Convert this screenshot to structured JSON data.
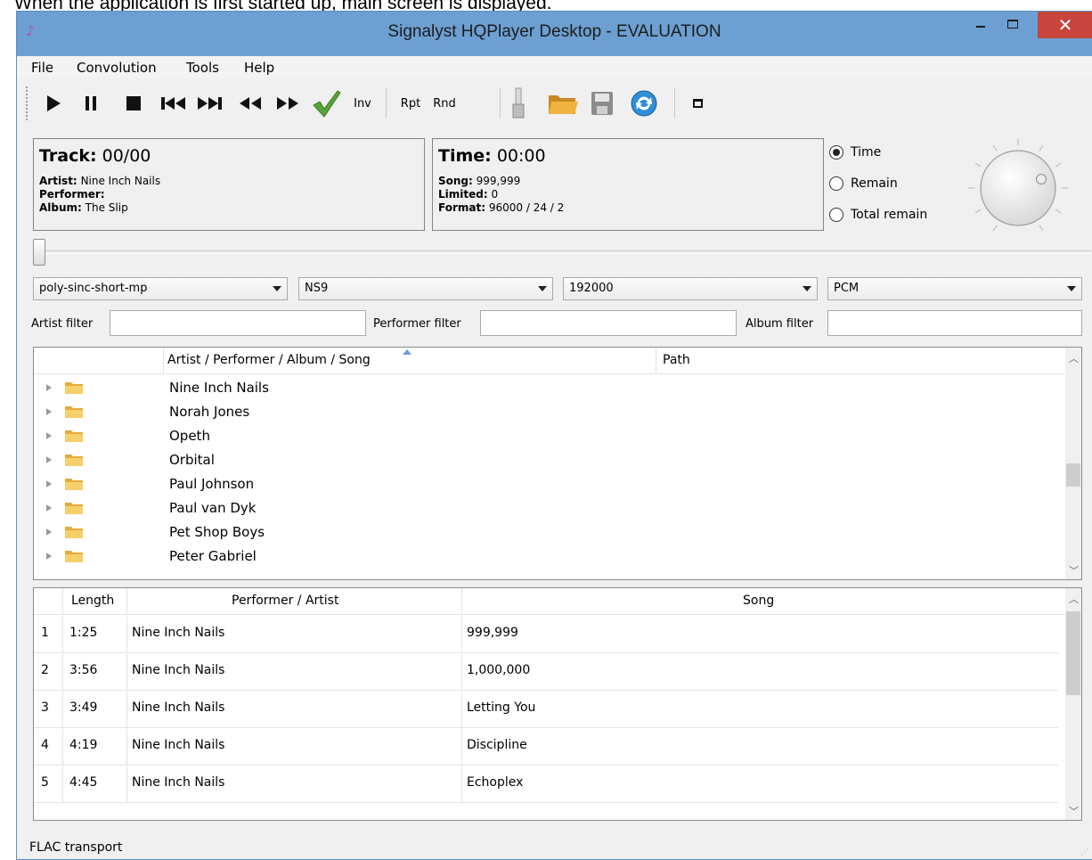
{
  "caption": "When the application is first started up, main screen is displayed.",
  "window": {
    "title": "Signalyst HQPlayer Desktop - EVALUATION"
  },
  "menu": [
    "File",
    "Convolution",
    "Tools",
    "Help"
  ],
  "toolbar": {
    "inv": "Inv",
    "rpt": "Rpt",
    "rnd": "Rnd"
  },
  "track_panel": {
    "track_label": "Track:",
    "track_value": "00/00",
    "artist_label": "Artist:",
    "artist": "Nine Inch Nails",
    "performer_label": "Performer:",
    "performer": "",
    "album_label": "Album:",
    "album": "The Slip"
  },
  "time_panel": {
    "time_label": "Time:",
    "time_value": "00:00",
    "song_label": "Song:",
    "song": "999,999",
    "limited_label": "Limited:",
    "limited": "0",
    "format_label": "Format:",
    "format": "96000 / 24 / 2"
  },
  "time_mode": {
    "options": [
      "Time",
      "Remain",
      "Total remain"
    ],
    "selected": "Time"
  },
  "combos": {
    "filter": "poly-sinc-short-mp",
    "shaper": "NS9",
    "rate": "192000",
    "mode": "PCM"
  },
  "filters": {
    "artist_label": "Artist filter",
    "performer_label": "Performer filter",
    "album_label": "Album filter",
    "artist_value": "",
    "performer_value": "",
    "album_value": ""
  },
  "library": {
    "columns": [
      "Artist / Performer / Album / Song",
      "Path"
    ],
    "items": [
      "Nine Inch Nails",
      "Norah Jones",
      "Opeth",
      "Orbital",
      "Paul Johnson",
      "Paul van Dyk",
      "Pet Shop Boys",
      "Peter Gabriel"
    ]
  },
  "playlist": {
    "columns": [
      "Length",
      "Performer / Artist",
      "Song"
    ],
    "rows": [
      {
        "num": "1",
        "length": "1:25",
        "artist": "Nine Inch Nails",
        "song": "999,999"
      },
      {
        "num": "2",
        "length": "3:56",
        "artist": "Nine Inch Nails",
        "song": "1,000,000"
      },
      {
        "num": "3",
        "length": "3:49",
        "artist": "Nine Inch Nails",
        "song": "Letting You"
      },
      {
        "num": "4",
        "length": "4:19",
        "artist": "Nine Inch Nails",
        "song": "Discipline"
      },
      {
        "num": "5",
        "length": "4:45",
        "artist": "Nine Inch Nails",
        "song": "Echoplex"
      }
    ]
  },
  "status": "FLAC transport",
  "colors": {
    "titlebar": "#6d9fd2",
    "close": "#c7453d",
    "check": "#5aa33a",
    "folder": "#e8a93b"
  }
}
